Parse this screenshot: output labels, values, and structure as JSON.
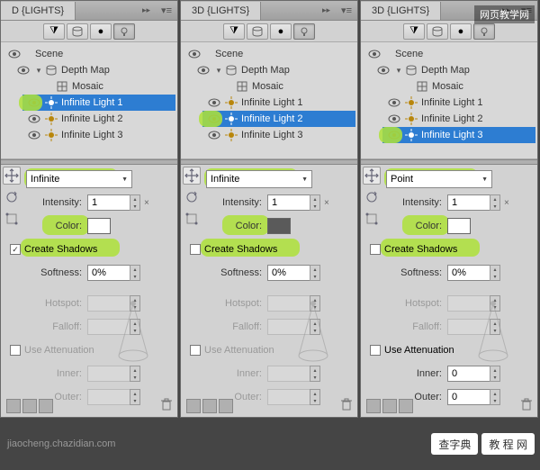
{
  "watermark": "网页教学网",
  "footer_site": "jiaocheng.chazidian.com",
  "footer_badges": [
    "查字典",
    "教 程 网"
  ],
  "panels": [
    {
      "tab": "D {LIGHTS}",
      "scene_label": "Scene",
      "tree": {
        "depth_map": "Depth Map",
        "mosaic": "Mosaic",
        "lights": [
          "Infinite Light 1",
          "Infinite Light 2",
          "Infinite Light 3"
        ],
        "selected": 0
      },
      "light_type": "Infinite",
      "intensity_label": "Intensity:",
      "intensity": "1",
      "color_label": "Color:",
      "color": "#ffffff",
      "create_shadows_label": "Create Shadows",
      "create_shadows": true,
      "softness_label": "Softness:",
      "softness": "0%",
      "hotspot_label": "Hotspot:",
      "falloff_label": "Falloff:",
      "use_atten_label": "Use Attenuation",
      "use_atten_enabled": false,
      "inner_label": "Inner:",
      "outer_label": "Outer:",
      "highlights": [
        "light_row",
        "type",
        "color",
        "shadows"
      ]
    },
    {
      "tab": "3D {LIGHTS}",
      "scene_label": "Scene",
      "tree": {
        "depth_map": "Depth Map",
        "mosaic": "Mosaic",
        "lights": [
          "Infinite Light 1",
          "Infinite Light 2",
          "Infinite Light 3"
        ],
        "selected": 1
      },
      "light_type": "Infinite",
      "intensity_label": "Intensity:",
      "intensity": "1",
      "color_label": "Color:",
      "color": "#5a5a5a",
      "create_shadows_label": "Create Shadows",
      "create_shadows": false,
      "softness_label": "Softness:",
      "softness": "0%",
      "hotspot_label": "Hotspot:",
      "falloff_label": "Falloff:",
      "use_atten_label": "Use Attenuation",
      "use_atten_enabled": false,
      "inner_label": "Inner:",
      "outer_label": "Outer:",
      "highlights": [
        "light_row",
        "type",
        "color",
        "shadows"
      ]
    },
    {
      "tab": "3D {LIGHTS}",
      "scene_label": "Scene",
      "tree": {
        "depth_map": "Depth Map",
        "mosaic": "Mosaic",
        "lights": [
          "Infinite Light 1",
          "Infinite Light 2",
          "Infinite Light 3"
        ],
        "selected": 2
      },
      "light_type": "Point",
      "intensity_label": "Intensity:",
      "intensity": "1",
      "color_label": "Color:",
      "color": "#ffffff",
      "create_shadows_label": "Create Shadows",
      "create_shadows": false,
      "softness_label": "Softness:",
      "softness": "0%",
      "hotspot_label": "Hotspot:",
      "falloff_label": "Falloff:",
      "use_atten_label": "Use Attenuation",
      "use_atten_enabled": true,
      "inner_label": "Inner:",
      "outer_label": "Outer:",
      "highlights": [
        "light_row",
        "type",
        "color",
        "shadows"
      ]
    }
  ]
}
